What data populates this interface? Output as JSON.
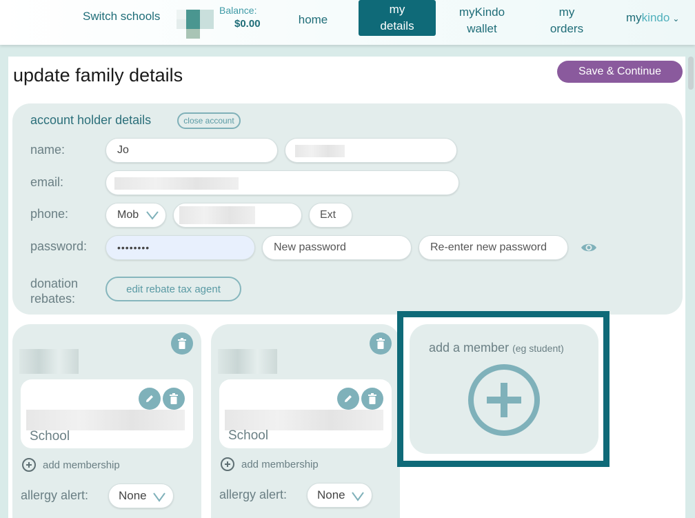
{
  "nav": {
    "switch_schools": "Switch schools",
    "balance_label": "Balance:",
    "balance_value": "$0.00",
    "home": "home",
    "my_details_1": "my",
    "my_details_2": "details",
    "wallet_1": "myKindo",
    "wallet_2": "wallet",
    "orders_1": "my",
    "orders_2": "orders",
    "account_my": "my",
    "account_kindo": "kindo"
  },
  "page": {
    "title": "update family details",
    "save_label": "Save & Continue"
  },
  "account": {
    "section_title": "account holder details",
    "close_account": "close account",
    "name_label": "name:",
    "first_name": "Jo",
    "email_label": "email:",
    "phone_label": "phone:",
    "phone_type": "Mob",
    "ext_placeholder": "Ext",
    "password_label": "password:",
    "password_value": "••••••••",
    "new_password_placeholder": "New password",
    "reenter_password_placeholder": "Re-enter new password",
    "donation_label_1": "donation",
    "donation_label_2": "rebates:",
    "rebate_button": "edit rebate tax agent"
  },
  "members": [
    {
      "school_label": "School",
      "add_membership": "add membership",
      "allergy_label": "allergy alert:",
      "allergy_value": "None"
    },
    {
      "school_label": "School",
      "add_membership": "add membership",
      "allergy_label": "allergy alert:",
      "allergy_value": "None"
    }
  ],
  "add_member": {
    "title": "add a member",
    "subtitle": "(eg student)"
  },
  "colors": {
    "brand": "#0f6a78",
    "save": "#8a5a9d",
    "card": "#e3edec",
    "icon": "#7fb1ba"
  }
}
